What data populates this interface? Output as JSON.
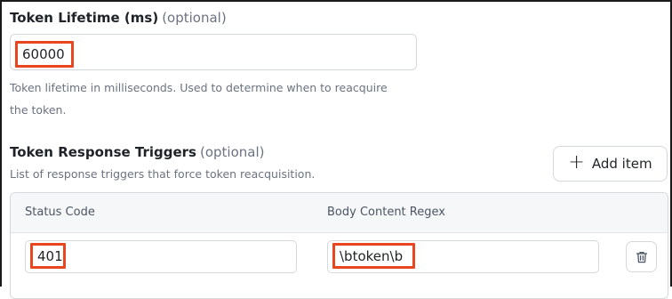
{
  "token_lifetime": {
    "label": "Token Lifetime (ms)",
    "optional": "(optional)",
    "value": "60000",
    "help_line1": "Token lifetime in milliseconds. Used to determine when to reacquire",
    "help_line2": "the token."
  },
  "token_response_triggers": {
    "label": "Token Response Triggers",
    "optional": "(optional)",
    "help": "List of response triggers that force token reacquisition.",
    "add_item_label": "Add item",
    "columns": [
      "Status Code",
      "Body Content Regex"
    ],
    "rows": [
      {
        "status_code": "401",
        "body_content_regex": "\\btoken\\b"
      }
    ]
  },
  "colors": {
    "highlight": "#e8461f",
    "border": "#d5d8dc",
    "muted_text": "#6b7280"
  },
  "icons": [
    "plus-icon",
    "trash-icon"
  ]
}
